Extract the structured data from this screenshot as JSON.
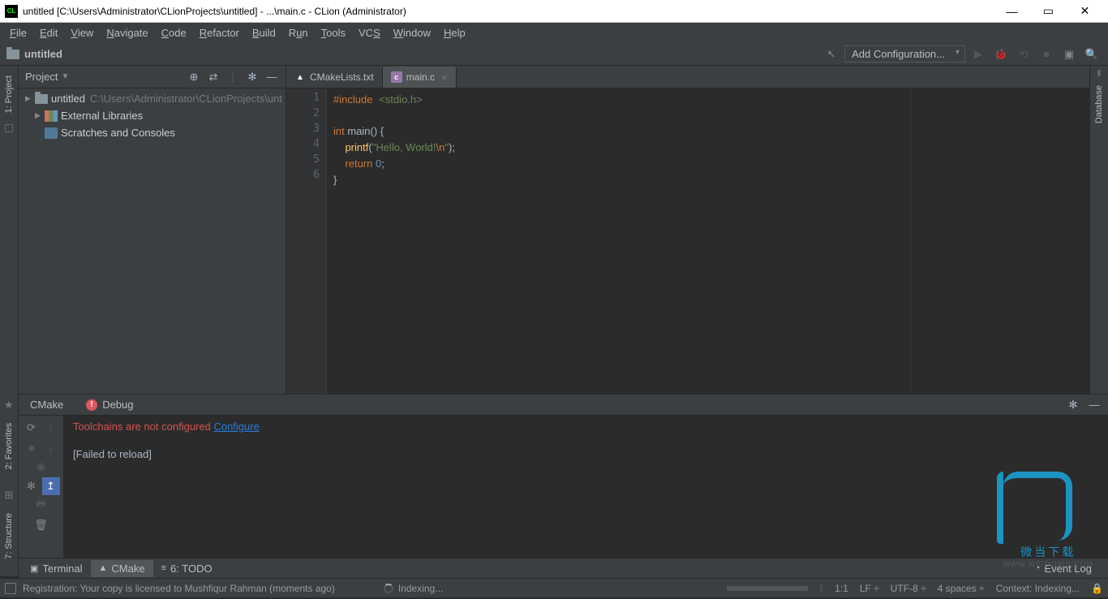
{
  "window": {
    "title": "untitled [C:\\Users\\Administrator\\CLionProjects\\untitled] - ...\\main.c - CLion (Administrator)"
  },
  "menu": {
    "file": "File",
    "edit": "Edit",
    "view": "View",
    "navigate": "Navigate",
    "code": "Code",
    "refactor": "Refactor",
    "build": "Build",
    "run": "Run",
    "tools": "Tools",
    "vcs": "VCS",
    "window": "Window",
    "help": "Help"
  },
  "navbar": {
    "crumb": "untitled",
    "config": "Add Configuration..."
  },
  "projectPanel": {
    "title": "Project",
    "tree": {
      "root": {
        "label": "untitled",
        "path": "C:\\Users\\Administrator\\CLionProjects\\unt"
      },
      "ext": "External Libraries",
      "scr": "Scratches and Consoles"
    }
  },
  "leftGutter": {
    "project": "1: Project",
    "favorites": "2: Favorites",
    "structure": "7: Structure"
  },
  "rightGutter": {
    "database": "Database"
  },
  "tabs": {
    "cmake": "CMakeLists.txt",
    "main": "main.c"
  },
  "code": {
    "l1a": "#include",
    "l1b": "<stdio.h>",
    "l3a": "int",
    "l3b": " main() {",
    "l4a": "    printf",
    "l4b": "(",
    "l4c": "\"Hello, World!",
    "l4d": "\\n",
    "l4e": "\"",
    "l4f": ");",
    "l5a": "    ",
    "l5b": "return",
    "l5c": " ",
    "l5d": "0",
    "l5e": ";",
    "l6": "}"
  },
  "toolTabs": {
    "cmake": "CMake",
    "debug": "Debug"
  },
  "toolOutput": {
    "err": "Toolchains are not configured ",
    "cfg": "Configure",
    "failed": "[Failed to reload]"
  },
  "bottomTools": {
    "terminal": "Terminal",
    "cmake": "CMake",
    "todo": "6: TODO",
    "eventlog": "Event Log"
  },
  "status": {
    "msg": "Registration: Your copy is licensed to Mushfiqur Rahman (moments ago)",
    "indexing": "Indexing...",
    "pos": "1:1",
    "le": "LF",
    "enc": "UTF-8",
    "indent": "4 spaces",
    "ctx": "Context: Indexing...",
    "indexing2": "Indexing..."
  },
  "watermark": {
    "txt": "微当下载",
    "url": "WWW.WEIDOWN.COM"
  }
}
